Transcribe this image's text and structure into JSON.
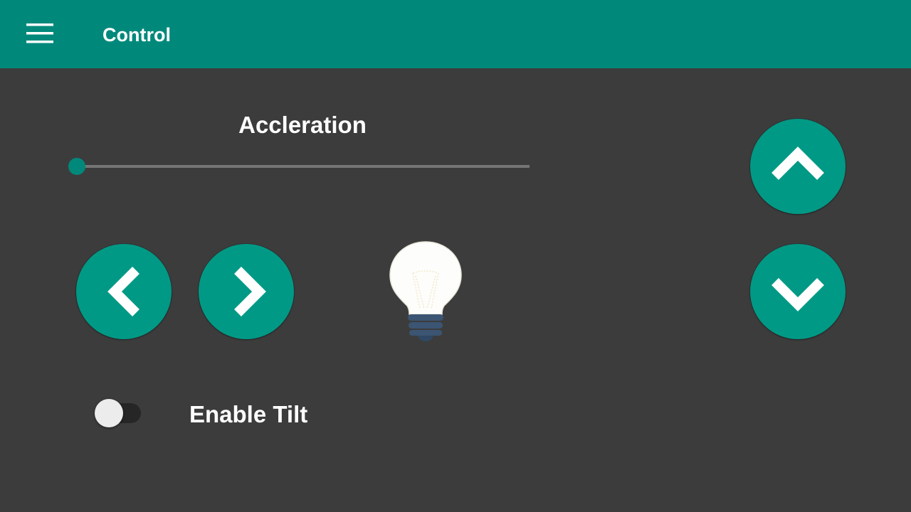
{
  "app_bar": {
    "title": "Control",
    "menu_icon": "hamburger-menu-icon",
    "color": "#00897b"
  },
  "acceleration": {
    "label": "Accleration",
    "value": 0,
    "accent_color": "#00897b"
  },
  "buttons": {
    "left_icon": "chevron-left-icon",
    "right_icon": "chevron-right-icon",
    "up_icon": "chevron-up-icon",
    "down_icon": "chevron-down-icon",
    "color": "#009985"
  },
  "light": {
    "icon": "light-bulb-icon",
    "state": "on"
  },
  "tilt": {
    "label": "Enable Tilt",
    "enabled": false
  },
  "colors": {
    "background": "#3c3c3c",
    "accent": "#009688"
  }
}
